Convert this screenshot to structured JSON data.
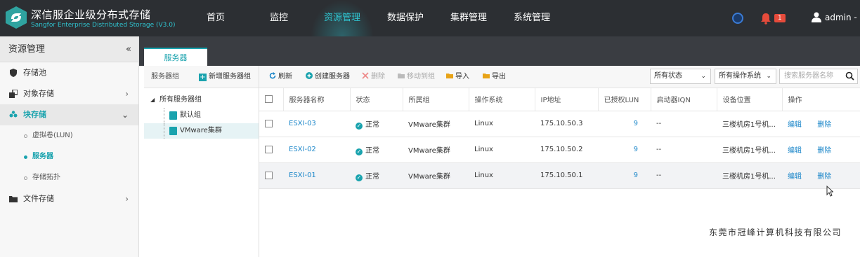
{
  "brand": {
    "title": "深信服企业级分布式存储",
    "subtitle": "Sangfor Enterprise Distributed Storage (V3.0)"
  },
  "nav": {
    "items": [
      "首页",
      "监控",
      "资源管理",
      "数据保护",
      "集群管理",
      "系统管理"
    ],
    "active": "资源管理"
  },
  "user": {
    "alert_count": "1",
    "name": "admin -"
  },
  "sidebar": {
    "title": "资源管理",
    "collapse": "«",
    "items": [
      {
        "label": "存储池",
        "icon": "shield-icon"
      },
      {
        "label": "对象存储",
        "icon": "object-storage-icon"
      },
      {
        "label": "块存储",
        "icon": "block-storage-icon"
      },
      {
        "label": "文件存储",
        "icon": "folder-icon"
      }
    ],
    "block_sub": [
      "虚拟卷(LUN)",
      "服务器",
      "存储拓扑"
    ],
    "active_sub": "服务器"
  },
  "tabs": {
    "active": "服务器"
  },
  "group_pane": {
    "header": "服务器组",
    "add_label": "新增服务器组",
    "root": "所有服务器组",
    "nodes": [
      "默认组",
      "VMware集群"
    ],
    "selected": "VMware集群"
  },
  "toolbar": {
    "refresh": "刷新",
    "create": "创建服务器",
    "delete": "删除",
    "move": "移动到组",
    "import": "导入",
    "export": "导出",
    "status_filter": "所有状态",
    "os_filter": "所有操作系统",
    "search_placeholder": "搜索服务器名称"
  },
  "table": {
    "headers": [
      "服务器名称",
      "状态",
      "所属组",
      "操作系统",
      "IP地址",
      "已授权LUN",
      "启动器IQN",
      "设备位置",
      "操作"
    ],
    "rows": [
      {
        "name": "ESXI-03",
        "status": "正常",
        "group": "VMware集群",
        "os": "Linux",
        "ip": "175.10.50.3",
        "lun": "9",
        "iqn": "--",
        "location": "三楼机房1号机...",
        "edit": "编辑",
        "delete": "删除"
      },
      {
        "name": "ESXI-02",
        "status": "正常",
        "group": "VMware集群",
        "os": "Linux",
        "ip": "175.10.50.2",
        "lun": "9",
        "iqn": "--",
        "location": "三楼机房1号机...",
        "edit": "编辑",
        "delete": "删除"
      },
      {
        "name": "ESXI-01",
        "status": "正常",
        "group": "VMware集群",
        "os": "Linux",
        "ip": "175.10.50.1",
        "lun": "9",
        "iqn": "--",
        "location": "三楼机房1号机...",
        "edit": "编辑",
        "delete": "删除"
      }
    ]
  },
  "footer": {
    "company": "东莞市冠峰计算机科技有限公司"
  },
  "colors": {
    "accent": "#1aa3ae",
    "topbar": "#2c2f33",
    "link": "#1a86c9",
    "badge": "#e64b3b"
  }
}
